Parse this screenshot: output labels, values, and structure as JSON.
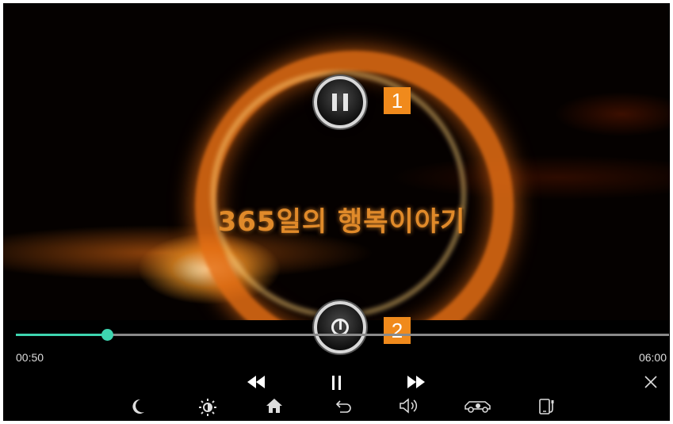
{
  "video": {
    "overlay_title": "365일의 행복이야기"
  },
  "annotations": {
    "badge_1": "1",
    "badge_2": "2"
  },
  "player": {
    "state": "playing",
    "current_time": "00:50",
    "total_time": "06:00",
    "progress_fraction": 0.139,
    "accent_color": "#3ed5b0",
    "controls": [
      "rewind-icon",
      "pause-icon",
      "fast-forward-icon",
      "close-icon"
    ]
  },
  "system_bar": {
    "icons": [
      "moon-icon",
      "brightness-icon",
      "home-icon",
      "back-icon",
      "volume-icon",
      "car-icon",
      "phone-icon"
    ]
  },
  "colors": {
    "badge": "#f08a1c",
    "track": "#8a8a8a",
    "background": "#000000"
  }
}
